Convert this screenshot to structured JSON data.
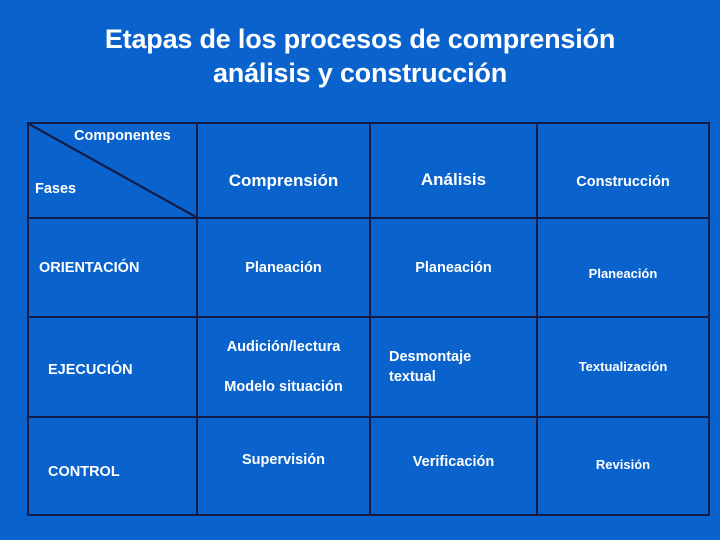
{
  "slide": {
    "background_color": "#0a62cc",
    "text_color": "#ffffff",
    "border_color": "#131c47",
    "title_line_1": "Etapas de los procesos de comprensión",
    "title_line_2": "análisis y construcción"
  },
  "table": {
    "corner": {
      "top_label": "Componentes",
      "bottom_label": "Fases"
    },
    "column_headers": [
      "Comprensión",
      "Análisis",
      "Construcción"
    ],
    "rows": [
      {
        "phase": "ORIENTACIÓN",
        "cells": [
          {
            "lines": [
              "Planeación"
            ]
          },
          {
            "lines": [
              "Planeación"
            ]
          },
          {
            "lines": [
              "Planeación"
            ]
          }
        ]
      },
      {
        "phase": "EJECUCIÓN",
        "cells": [
          {
            "lines": [
              "Audición/lectura",
              "Modelo situación"
            ]
          },
          {
            "lines": [
              "Desmontaje",
              "textual"
            ]
          },
          {
            "lines": [
              "Textualización"
            ]
          }
        ]
      },
      {
        "phase": "CONTROL",
        "cells": [
          {
            "lines": [
              "Supervisión"
            ]
          },
          {
            "lines": [
              "Verificación"
            ]
          },
          {
            "lines": [
              "Revisión"
            ]
          }
        ]
      }
    ]
  }
}
